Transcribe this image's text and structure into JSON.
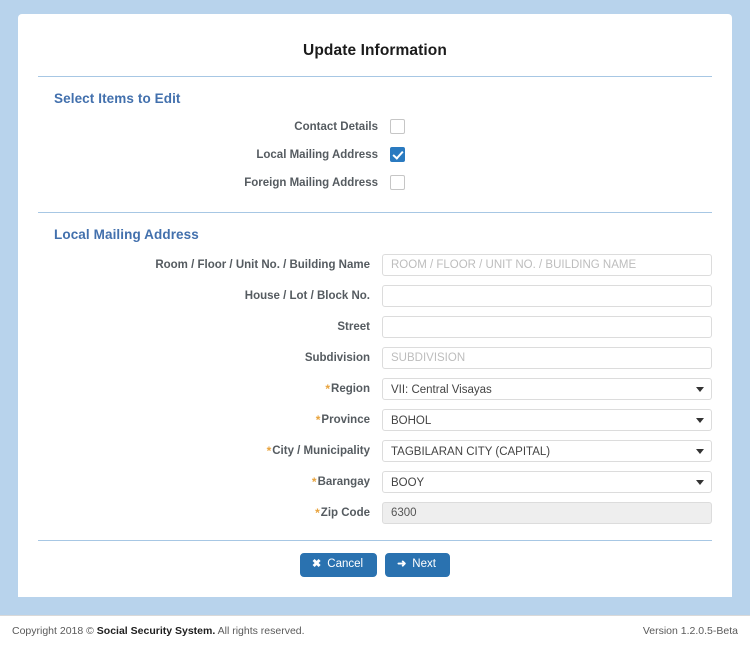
{
  "header": {
    "title": "Update Information"
  },
  "select_section": {
    "title": "Select Items to Edit",
    "items": [
      {
        "label": "Contact Details",
        "checked": false
      },
      {
        "label": "Local Mailing Address",
        "checked": true
      },
      {
        "label": "Foreign Mailing Address",
        "checked": false
      }
    ]
  },
  "address_section": {
    "title": "Local Mailing Address",
    "fields": [
      {
        "label": "Room / Floor / Unit No. / Building Name",
        "required": false,
        "type": "text",
        "value": "",
        "placeholder": "ROOM / FLOOR / UNIT NO. / BUILDING NAME",
        "disabled": false
      },
      {
        "label": "House / Lot / Block No.",
        "required": false,
        "type": "text",
        "value": "",
        "placeholder": "",
        "disabled": false
      },
      {
        "label": "Street",
        "required": false,
        "type": "text",
        "value": "",
        "placeholder": "",
        "disabled": false
      },
      {
        "label": "Subdivision",
        "required": false,
        "type": "text",
        "value": "",
        "placeholder": "SUBDIVISION",
        "disabled": false
      },
      {
        "label": "Region",
        "required": true,
        "type": "select",
        "value": "VII: Central Visayas",
        "placeholder": "",
        "disabled": false
      },
      {
        "label": "Province",
        "required": true,
        "type": "select",
        "value": "BOHOL",
        "placeholder": "",
        "disabled": false
      },
      {
        "label": "City / Municipality",
        "required": true,
        "type": "select",
        "value": "TAGBILARAN CITY (CAPITAL)",
        "placeholder": "",
        "disabled": false
      },
      {
        "label": "Barangay",
        "required": true,
        "type": "select",
        "value": "BOOY",
        "placeholder": "",
        "disabled": false
      },
      {
        "label": "Zip Code",
        "required": true,
        "type": "text",
        "value": "6300",
        "placeholder": "",
        "disabled": true
      }
    ]
  },
  "actions": {
    "cancel": {
      "label": "Cancel",
      "icon": "close-icon",
      "glyph": "✖"
    },
    "next": {
      "label": "Next",
      "icon": "arrow-right-icon",
      "glyph": "➜"
    }
  },
  "footer": {
    "copyright_prefix": "Copyright 2018 © ",
    "org": "Social Security System.",
    "copyright_suffix": " All rights reserved.",
    "version": "Version 1.2.0.5-Beta"
  },
  "colors": {
    "accent_blue": "#4270ad",
    "button_blue": "#2a72b0",
    "checkbox_blue": "#2a7ac0",
    "required_asterisk": "#e8a33d",
    "page_background": "#b8d3ec",
    "divider": "#a7c7e4"
  },
  "required_marker": "*"
}
